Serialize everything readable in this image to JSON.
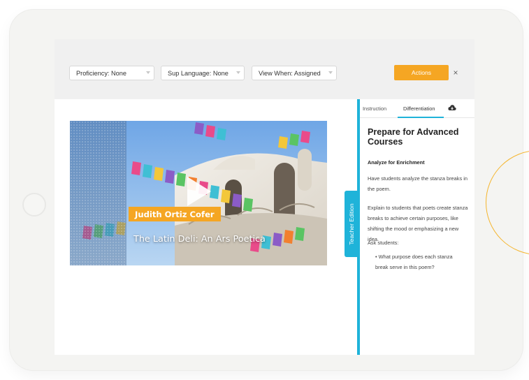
{
  "toolbar": {
    "proficiency": "Proficiency: None",
    "sup_language": "Sup Language: None",
    "view_when": "View When: Assigned",
    "actions_label": "Actions",
    "close_label": "×"
  },
  "video": {
    "author": "Judith Ortiz Cofer",
    "title": "The Latin Deli: An Ars Poetica"
  },
  "teacher_edition": {
    "label": "Teacher Edition"
  },
  "panel": {
    "tabs": [
      "Instruction",
      "Differentiation"
    ],
    "active_tab": "Differentiation",
    "title": "Prepare for Advanced Courses",
    "subheading": "Analyze for Enrichment",
    "paragraph1": "Have students analyze the stanza breaks in the poem.",
    "paragraph2": "Explain to students that poets create stanza breaks to achieve certain purposes, like shifting the mood or emphasizing a new idea.",
    "paragraph3": "Ask students:",
    "bullet1": "• What purpose does each stanza break serve in this poem?"
  },
  "colors": {
    "accent_orange": "#f5a623",
    "accent_blue": "#1fb3d9"
  },
  "icons": [
    "cloud-download-icon",
    "play-icon",
    "close-icon",
    "chevron-down-icon"
  ]
}
